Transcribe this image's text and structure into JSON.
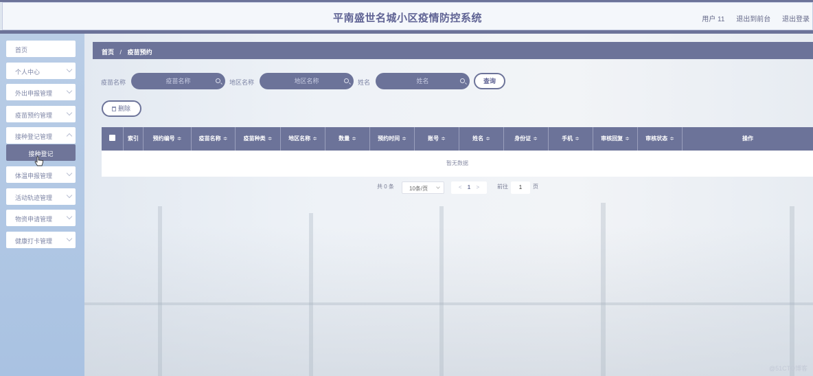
{
  "header": {
    "title": "平南盛世名城小区疫情防控系统",
    "user": "用户 11",
    "back_to_front": "退出到前台",
    "logout": "退出登录"
  },
  "sidebar": {
    "items": [
      {
        "label": "首页",
        "chevron": false
      },
      {
        "label": "个人中心",
        "chevron": true
      },
      {
        "label": "外出申报管理",
        "chevron": true
      },
      {
        "label": "疫苗预约管理",
        "chevron": true
      },
      {
        "label": "接种登记管理",
        "chevron": true
      },
      {
        "label": "接种登记",
        "chevron": false,
        "active": true
      },
      {
        "label": "体温申报管理",
        "chevron": true
      },
      {
        "label": "活动轨迹管理",
        "chevron": true
      },
      {
        "label": "物资申请管理",
        "chevron": true
      },
      {
        "label": "健康打卡管理",
        "chevron": true
      }
    ]
  },
  "breadcrumb": {
    "home": "首页",
    "separator": "/",
    "current": "疫苗预约"
  },
  "search": {
    "vaccine_label": "疫苗名称",
    "vaccine_placeholder": "疫苗名称",
    "region_label": "地区名称",
    "region_placeholder": "地区名称",
    "name_label": "姓名",
    "name_placeholder": "姓名",
    "query_button": "查询"
  },
  "actions": {
    "delete_button": "删除"
  },
  "table": {
    "columns": [
      "索引",
      "预约编号",
      "疫苗名称",
      "疫苗种类",
      "地区名称",
      "数量",
      "预约时间",
      "账号",
      "姓名",
      "身份证",
      "手机",
      "审核回复",
      "审核状态",
      "操作"
    ],
    "sort_symbol": "≑",
    "empty_text": "暂无数据"
  },
  "pagination": {
    "total": "共 0 条",
    "page_size": "10条/页",
    "current_page": "1",
    "prev": "<",
    "next": ">",
    "goto_label": "前往",
    "goto_value": "1",
    "page_unit": "页"
  },
  "watermark": "@51CTO博客",
  "colors": {
    "accent": "#6c7399",
    "sidebar": "#b0c7e4"
  }
}
